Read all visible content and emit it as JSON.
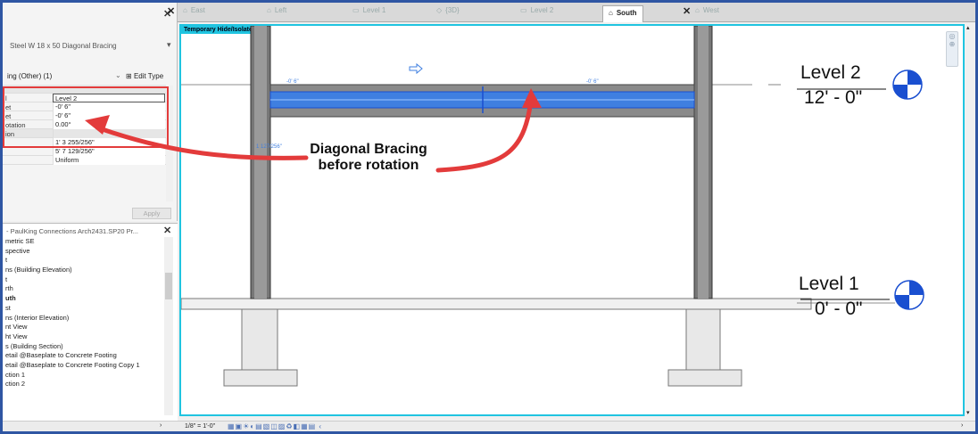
{
  "properties": {
    "type_name": "Steel W 18 x 50 Diagonal Bracing",
    "filter_label": "ing (Other) (1)",
    "edit_type_label": "Edit Type",
    "rows": [
      {
        "k": "l",
        "v": "Level 2"
      },
      {
        "k": "et",
        "v": "-0'  6\""
      },
      {
        "k": "et",
        "v": "-0'  6\""
      },
      {
        "k": "otation",
        "v": "0.00°"
      },
      {
        "k": "ion",
        "v": ""
      },
      {
        "k": "",
        "v": "1'  3 255/256\""
      },
      {
        "k": "",
        "v": "5'  7 129/256\""
      },
      {
        "k": "",
        "v": "Uniform"
      }
    ],
    "apply_label": "Apply"
  },
  "browser": {
    "title": "- PaulKing Connections Arch2431.SP20 Pr...",
    "items": [
      {
        "label": "metric SE",
        "bold": false
      },
      {
        "label": "spective",
        "bold": false
      },
      {
        "label": "t",
        "bold": false
      },
      {
        "label": "ns (Building Elevation)",
        "bold": false
      },
      {
        "label": "t",
        "bold": false
      },
      {
        "label": "rth",
        "bold": false
      },
      {
        "label": "uth",
        "bold": true
      },
      {
        "label": "st",
        "bold": false
      },
      {
        "label": "ns (Interior Elevation)",
        "bold": false
      },
      {
        "label": "nt View",
        "bold": false
      },
      {
        "label": "ht View",
        "bold": false
      },
      {
        "label": "s (Building Section)",
        "bold": false
      },
      {
        "label": "etail @Baseplate to Concrete Footing",
        "bold": false
      },
      {
        "label": "etail @Baseplate to Concrete Footing Copy 1",
        "bold": false
      },
      {
        "label": "ction 1",
        "bold": false
      },
      {
        "label": "ction 2",
        "bold": false
      }
    ]
  },
  "tabs": [
    {
      "label": "East",
      "active": false
    },
    {
      "label": "Left",
      "active": false
    },
    {
      "label": "Level 1",
      "active": false
    },
    {
      "label": "{3D}",
      "active": false
    },
    {
      "label": "Level 2",
      "active": false
    },
    {
      "label": "South",
      "active": true
    },
    {
      "label": "West",
      "active": false
    }
  ],
  "canvas": {
    "temp_mode_label": "Temporary Hide/Isolate",
    "annotation_line1": "Diagonal Bracing",
    "annotation_line2": "before rotation",
    "level2_name": "Level 2",
    "level2_elev": "12' - 0\"",
    "level1_name": "Level 1",
    "level1_elev": "0' - 0\"",
    "dim_left": "-0'  6\"",
    "dim_right": "-0'  6\"",
    "dim_side": "1  127/256\""
  },
  "status": {
    "scale": "1/8\" = 1'-0\""
  },
  "colors": {
    "accent": "#20c4e0",
    "highlight_beam": "#3f7fe0",
    "arrow": "#e33b3b",
    "level_marker": "#1a4fd0"
  }
}
